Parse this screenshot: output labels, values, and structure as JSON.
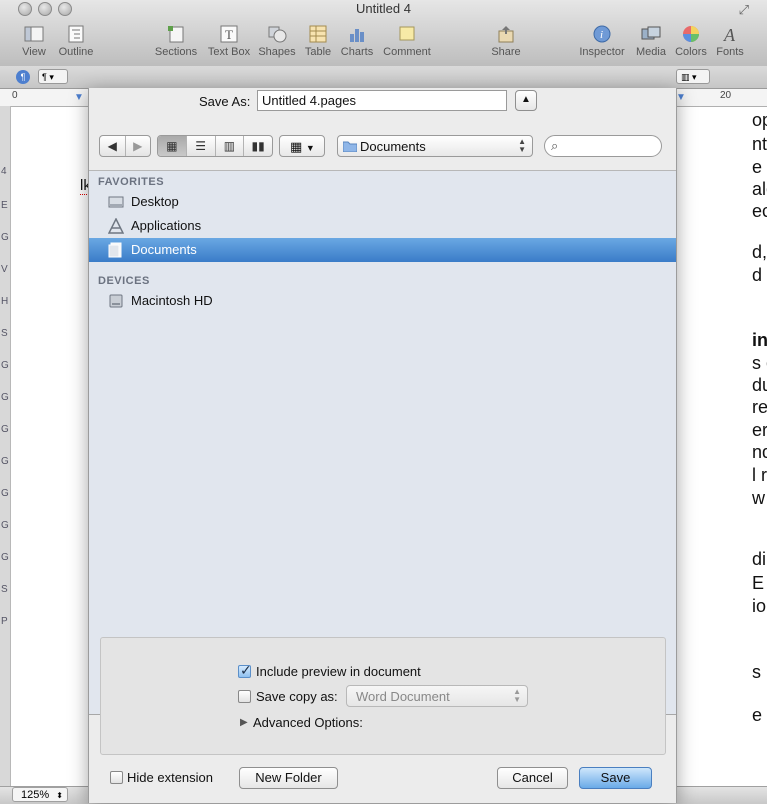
{
  "window": {
    "title": "Untitled 4"
  },
  "toolbar": {
    "items": [
      {
        "label": "View",
        "icon": "view-icon"
      },
      {
        "label": "Outline",
        "icon": "outline-icon"
      },
      {
        "label": "Sections",
        "icon": "sections-icon"
      },
      {
        "label": "Text Box",
        "icon": "textbox-icon"
      },
      {
        "label": "Shapes",
        "icon": "shapes-icon"
      },
      {
        "label": "Table",
        "icon": "table-icon"
      },
      {
        "label": "Charts",
        "icon": "charts-icon"
      },
      {
        "label": "Comment",
        "icon": "comment-icon"
      },
      {
        "label": "Share",
        "icon": "share-icon"
      },
      {
        "label": "Inspector",
        "icon": "inspector-icon"
      },
      {
        "label": "Media",
        "icon": "media-icon"
      },
      {
        "label": "Colors",
        "icon": "colors-icon"
      },
      {
        "label": "Fonts",
        "icon": "fonts-icon"
      }
    ]
  },
  "ruler": {
    "mark_0": "0",
    "mark_20": "20"
  },
  "sidebar_letters": [
    "4",
    "E",
    "G",
    "V",
    "H",
    "S",
    "G",
    "G",
    "G",
    "G",
    "G",
    "G",
    "G",
    "S",
    "P"
  ],
  "document_fragments": [
    "op",
    "nt,",
    "e -",
    "ale",
    "ec",
    "d,",
    "d",
    "in",
    "s c",
    "du",
    "rea",
    "er",
    "nd",
    "l r",
    "w",
    "diu",
    "E",
    "io",
    "s i",
    "e"
  ],
  "document_left_text": "lk",
  "status": {
    "zoom": "125%"
  },
  "save_dialog": {
    "save_as_label": "Save As:",
    "filename": "Untitled 4.pages",
    "location": "Documents",
    "search_placeholder": "",
    "favorites_header": "FAVORITES",
    "favorites": [
      {
        "label": "Desktop",
        "icon": "desktop-icon",
        "selected": false
      },
      {
        "label": "Applications",
        "icon": "applications-icon",
        "selected": false
      },
      {
        "label": "Documents",
        "icon": "documents-icon",
        "selected": true
      }
    ],
    "devices_header": "DEVICES",
    "devices": [
      {
        "label": "Macintosh HD",
        "icon": "harddrive-icon"
      }
    ],
    "options": {
      "include_preview_label": "Include preview in document",
      "include_preview_checked": true,
      "save_copy_label": "Save copy as:",
      "save_copy_checked": false,
      "save_copy_format": "Word Document",
      "advanced_label": "Advanced Options:"
    },
    "hide_extension_label": "Hide extension",
    "hide_extension_checked": false,
    "new_folder_label": "New Folder",
    "cancel_label": "Cancel",
    "save_label": "Save"
  }
}
